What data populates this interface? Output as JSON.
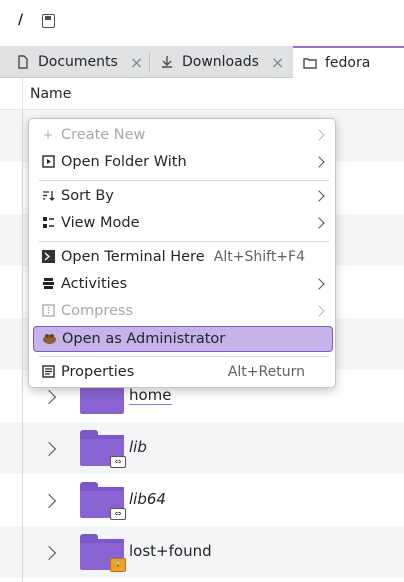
{
  "path_bar": {
    "root": "/"
  },
  "tabs": [
    {
      "label": "Documents",
      "icon": "document-icon",
      "close": "×"
    },
    {
      "label": "Downloads",
      "icon": "download-icon",
      "close": "×"
    },
    {
      "label": "fedora",
      "icon": "folder-icon",
      "active": true
    }
  ],
  "header": {
    "name_col": "Name"
  },
  "rows": [
    {
      "name": "home",
      "emblem": ""
    },
    {
      "name": "lib",
      "emblem": "link"
    },
    {
      "name": "lib64",
      "emblem": "link"
    },
    {
      "name": "lost+found",
      "emblem": "lock"
    }
  ],
  "context_menu": {
    "items": [
      {
        "label": "Create New",
        "icon": "plus-icon",
        "disabled": true,
        "submenu": true
      },
      {
        "label": "Open Folder With",
        "icon": "open-with-icon",
        "submenu": true
      },
      {
        "label": "Sort By",
        "icon": "sort-icon",
        "submenu": true
      },
      {
        "label": "View Mode",
        "icon": "view-mode-icon",
        "submenu": true
      },
      {
        "label": "Open Terminal Here",
        "icon": "terminal-icon",
        "shortcut": "Alt+Shift+F4"
      },
      {
        "label": "Activities",
        "icon": "activities-icon",
        "submenu": true
      },
      {
        "label": "Compress",
        "icon": "compress-icon",
        "disabled": true,
        "submenu": true
      },
      {
        "label": "Open as Administrator",
        "icon": "admin-icon",
        "highlighted": true
      },
      {
        "label": "Properties",
        "icon": "properties-icon",
        "shortcut": "Alt+Return"
      }
    ]
  },
  "colors": {
    "accent": "#9b6fd6",
    "folder": "#8a63d2",
    "highlight": "#c5b3ea"
  }
}
